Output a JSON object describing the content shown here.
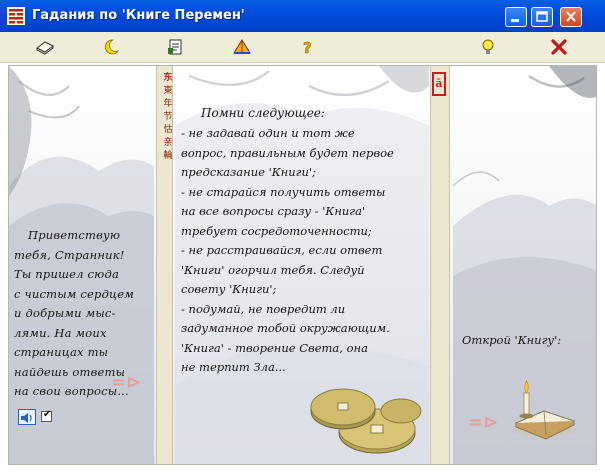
{
  "window": {
    "title": "Гадания по 'Книге Перемен'"
  },
  "toolbar": {
    "buttons": [
      {
        "name": "book-tool-button",
        "icon": "book-icon"
      },
      {
        "name": "moon-tool-button",
        "icon": "moon-icon"
      },
      {
        "name": "notes-tool-button",
        "icon": "document-icon"
      },
      {
        "name": "pyramid-tool-button",
        "icon": "pyramid-icon"
      },
      {
        "name": "help-tool-button",
        "icon": "question-icon"
      },
      {
        "name": "idea-tool-button",
        "icon": "lightbulb-icon"
      },
      {
        "name": "exit-tool-button",
        "icon": "close-x-icon"
      }
    ]
  },
  "left_page": {
    "greeting": [
      "Приветствую",
      "тебя, Странник!",
      "Ты пришел сюда",
      "с чистым сердцем",
      "и добрыми мыс-",
      "лями. На моих",
      "страницах ты",
      "найдешь ответы",
      "на свои вопросы..."
    ],
    "sound_checked": true,
    "check_mark": "✔"
  },
  "spine": {
    "chars": [
      "东",
      "東",
      "年",
      "节",
      "怙",
      "亲",
      "輪"
    ],
    "seal": "ā"
  },
  "middle_page": {
    "title": "Помни следующее:",
    "lines": [
      "- не задавай один и тот же",
      "вопрос, правильным будет первое",
      "предсказание 'Книги';",
      "- не старайся получить ответы",
      "на все вопросы сразу - 'Книга'",
      "требует сосредоточенности;",
      "- не расстраивайся, если ответ",
      "'Книги' огорчил тебя. Следуй",
      "совету 'Книги';",
      "- подумай, не повредит ли",
      "задуманное тобой окружающим.",
      "'Книга' - творение Света, она",
      "не терпит Зла..."
    ]
  },
  "right_page": {
    "open_label": "Открой 'Книгу':"
  },
  "arrows": {
    "glyph": "=⊳"
  },
  "colors": {
    "titlebar": "#0050e0",
    "toolbar": "#f0edda",
    "spine": "#ebe7d0",
    "arrow": "#e4a09a"
  }
}
